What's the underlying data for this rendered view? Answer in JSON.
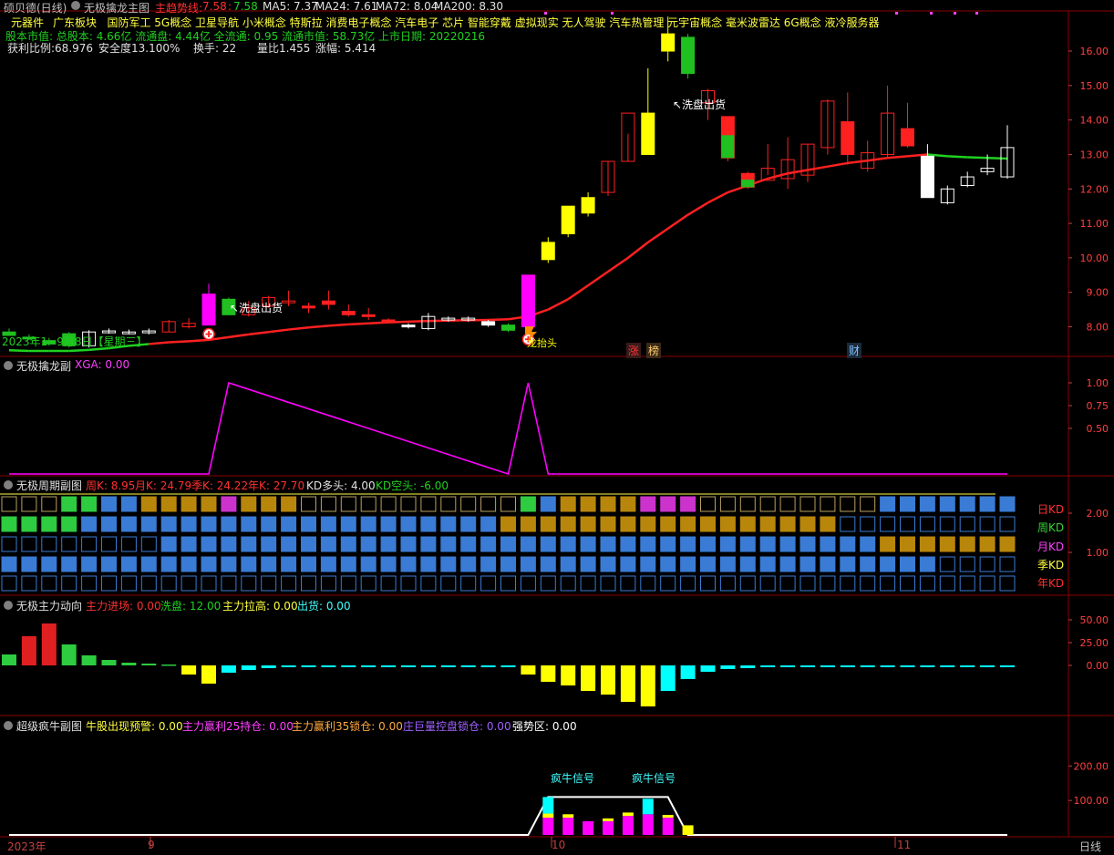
{
  "main": {
    "window_title": "硕贝德(日线)",
    "indicator_name": "无极擒龙主图",
    "trend_label": "主趋势线:",
    "trend_v1": "7.58",
    "trend_v2": "7.58",
    "ma5": "MA5: 7.37",
    "ma24": "MA24: 7.61",
    "ma72": "MA72: 8.04",
    "ma200": "MA200: 8.30",
    "concepts_head": "元器件",
    "concepts": "广东板块   国防军工 5G概念 卫星导航 小米概念 特斯拉 消费电子概念 汽车电子 芯片 智能穿戴 虚拟现实 无人驾驶 汽车热管理 元宇宙概念 毫米波雷达 6G概念 液冷服务器",
    "info_line": "股本市值: 总股本: 4.66亿 流通盘: 4.44亿 全流通: 0.95 流通市值: 58.73亿 上市日期: 20220216",
    "profit_ratio": "获利比例:68.976",
    "safety": "安全度13.100%",
    "turnover": "换手: 22",
    "vol_ratio": "量比1.455",
    "change": "涨幅: 5.414",
    "date_label": "2023年1~9月8日【星期三】",
    "wash_label_1": "↖洗盘出货",
    "wash_label_2": "↖洗盘出货",
    "dragon_label": "龙抬头",
    "events": [
      "涨",
      "榜",
      "财"
    ]
  },
  "sub1": {
    "title": "无极擒龙副",
    "value": "XGA: 0.00"
  },
  "sub2": {
    "title": "无极周期副图",
    "zhou": "周K: 8.95",
    "yue": "月K: 24.79",
    "ji": "季K: 24.22",
    "nian": "年K: 27.70",
    "duo": "KD多头: 4.00",
    "kong": "KD空头: -6.00",
    "rows": [
      {
        "label": "日KD",
        "color": "#ff3030"
      },
      {
        "label": "周KD",
        "color": "#3ad03a"
      },
      {
        "label": "月KD",
        "color": "#ff40ff"
      },
      {
        "label": "季KD",
        "color": "#ffff40"
      },
      {
        "label": "年KD",
        "color": "#ff3030"
      }
    ]
  },
  "sub3": {
    "title": "无极主力动向",
    "jinchang": "主力进场: 0.00",
    "xipan": "洗盘: 12.00",
    "lagao": "主力拉高: 0.00",
    "chuhuo": "出货: 0.00"
  },
  "sub4": {
    "title": "超级疯牛副图",
    "yujing": "牛股出现预警: 0.00",
    "chicang": "主力赢利25持仓: 0.00",
    "suocang35": "主力赢利35锁仓: 0.00",
    "kongpan": "庄巨量控盘锁仓: 0.00",
    "qiangshi": "强势区: 0.00",
    "signal1": "疯牛信号",
    "signal2": "疯牛信号"
  },
  "xaxis": {
    "year": "2023年",
    "m9": "9",
    "m10": "10",
    "m11": "11",
    "period": "日线"
  },
  "colors": {
    "up": "#ff2020",
    "down": "#20c020",
    "yellow": "#ffff00",
    "magenta": "#ff00ff",
    "cyan": "#00ffff",
    "blue": "#3a7bd5",
    "gold": "#b8860b"
  },
  "chart_data": [
    {
      "type": "candlestick",
      "title": "无极擒龙主图",
      "ylim": [
        7.3,
        16.9
      ],
      "y_ticks": [
        8.0,
        9.0,
        10.0,
        11.0,
        12.0,
        13.0,
        14.0,
        15.0,
        16.0
      ],
      "candles": [
        {
          "o": 7.85,
          "h": 7.95,
          "l": 7.75,
          "c": 7.75,
          "color": "green"
        },
        {
          "o": 7.7,
          "h": 7.78,
          "l": 7.62,
          "c": 7.65,
          "color": "green"
        },
        {
          "o": 7.6,
          "h": 7.68,
          "l": 7.45,
          "c": 7.5,
          "color": "green"
        },
        {
          "o": 7.8,
          "h": 7.85,
          "l": 7.4,
          "c": 7.45,
          "color": "green"
        },
        {
          "o": 7.45,
          "h": 7.9,
          "l": 7.4,
          "c": 7.85,
          "color": "white"
        },
        {
          "o": 7.85,
          "h": 7.95,
          "l": 7.8,
          "c": 7.88,
          "color": "white"
        },
        {
          "o": 7.85,
          "h": 7.92,
          "l": 7.78,
          "c": 7.85,
          "color": "white"
        },
        {
          "o": 7.85,
          "h": 7.95,
          "l": 7.78,
          "c": 7.88,
          "color": "white"
        },
        {
          "o": 7.85,
          "h": 8.2,
          "l": 7.85,
          "c": 8.15,
          "color": "red"
        },
        {
          "o": 8.0,
          "h": 8.25,
          "l": 7.95,
          "c": 8.1,
          "color": "red"
        },
        {
          "o": 8.05,
          "h": 9.25,
          "l": 8.05,
          "c": 8.95,
          "color": "magenta"
        },
        {
          "o": 8.8,
          "h": 8.85,
          "l": 8.4,
          "c": 8.35,
          "color": "green"
        },
        {
          "o": 8.35,
          "h": 8.75,
          "l": 8.3,
          "c": 8.55,
          "color": "red"
        },
        {
          "o": 8.6,
          "h": 8.9,
          "l": 8.55,
          "c": 8.85,
          "color": "red"
        },
        {
          "o": 8.7,
          "h": 9.05,
          "l": 8.6,
          "c": 8.75,
          "color": "red"
        },
        {
          "o": 8.6,
          "h": 8.7,
          "l": 8.4,
          "c": 8.55,
          "color": "redfill"
        },
        {
          "o": 8.75,
          "h": 9.05,
          "l": 8.5,
          "c": 8.65,
          "color": "redfill"
        },
        {
          "o": 8.45,
          "h": 8.65,
          "l": 8.3,
          "c": 8.35,
          "color": "redfill"
        },
        {
          "o": 8.35,
          "h": 8.55,
          "l": 8.2,
          "c": 8.3,
          "color": "redfill"
        },
        {
          "o": 8.2,
          "h": 8.25,
          "l": 8.1,
          "c": 8.15,
          "color": "redfill"
        },
        {
          "o": 8.05,
          "h": 8.1,
          "l": 7.95,
          "c": 8.0,
          "color": "whitefill"
        },
        {
          "o": 7.95,
          "h": 8.4,
          "l": 7.9,
          "c": 8.3,
          "color": "white"
        },
        {
          "o": 8.2,
          "h": 8.3,
          "l": 8.15,
          "c": 8.25,
          "color": "white"
        },
        {
          "o": 8.2,
          "h": 8.3,
          "l": 8.15,
          "c": 8.25,
          "color": "white"
        },
        {
          "o": 8.15,
          "h": 8.2,
          "l": 8.0,
          "c": 8.05,
          "color": "whitefill"
        },
        {
          "o": 8.05,
          "h": 8.1,
          "l": 7.85,
          "c": 7.9,
          "color": "greenfill"
        },
        {
          "o": 8.0,
          "h": 9.5,
          "l": 8.0,
          "c": 9.5,
          "color": "magenta"
        },
        {
          "o": 9.95,
          "h": 10.6,
          "l": 9.85,
          "c": 10.45,
          "color": "yellow"
        },
        {
          "o": 10.7,
          "h": 11.0,
          "l": 10.6,
          "c": 11.5,
          "color": "yellow"
        },
        {
          "o": 11.3,
          "h": 11.9,
          "l": 11.2,
          "c": 11.75,
          "color": "yellow"
        },
        {
          "o": 11.9,
          "h": 12.8,
          "l": 11.8,
          "c": 12.8,
          "color": "red"
        },
        {
          "o": 12.8,
          "h": 13.6,
          "l": 12.8,
          "c": 14.2,
          "color": "red"
        },
        {
          "o": 13.0,
          "h": 15.5,
          "l": 13.0,
          "c": 14.2,
          "color": "yellow"
        },
        {
          "o": 16.0,
          "h": 17.0,
          "l": 15.7,
          "c": 16.5,
          "color": "yellow"
        },
        {
          "o": 16.4,
          "h": 16.5,
          "l": 15.2,
          "c": 15.35,
          "color": "green"
        },
        {
          "o": 14.5,
          "h": 14.9,
          "l": 14.0,
          "c": 14.85,
          "color": "red"
        },
        {
          "o": 14.1,
          "h": 14.1,
          "l": 12.8,
          "c": 12.9,
          "color": "greenred"
        },
        {
          "o": 12.45,
          "h": 12.5,
          "l": 12.0,
          "c": 12.05,
          "color": "greenred"
        },
        {
          "o": 12.6,
          "h": 13.3,
          "l": 12.4,
          "c": 12.25,
          "color": "red"
        },
        {
          "o": 12.3,
          "h": 13.5,
          "l": 12.0,
          "c": 12.85,
          "color": "red"
        },
        {
          "o": 12.4,
          "h": 13.3,
          "l": 12.2,
          "c": 13.3,
          "color": "red"
        },
        {
          "o": 13.2,
          "h": 14.6,
          "l": 13.0,
          "c": 14.55,
          "color": "red"
        },
        {
          "o": 13.95,
          "h": 14.8,
          "l": 12.7,
          "c": 13.0,
          "color": "redfill"
        },
        {
          "o": 12.6,
          "h": 13.4,
          "l": 12.5,
          "c": 13.05,
          "color": "red"
        },
        {
          "o": 13.0,
          "h": 15.0,
          "l": 12.9,
          "c": 14.2,
          "color": "red"
        },
        {
          "o": 13.75,
          "h": 14.5,
          "l": 13.2,
          "c": 13.25,
          "color": "redfill"
        },
        {
          "o": 12.95,
          "h": 13.3,
          "l": 11.8,
          "c": 11.75,
          "color": "whitefill"
        },
        {
          "o": 11.6,
          "h": 12.1,
          "l": 11.55,
          "c": 12.0,
          "color": "white"
        },
        {
          "o": 12.1,
          "h": 12.5,
          "l": 12.05,
          "c": 12.35,
          "color": "white"
        },
        {
          "o": 12.5,
          "h": 13.0,
          "l": 12.4,
          "c": 12.6,
          "color": "white"
        },
        {
          "o": 12.35,
          "h": 13.85,
          "l": 12.3,
          "c": 13.2,
          "color": "white"
        }
      ],
      "trend_line": [
        7.32,
        7.3,
        7.3,
        7.3,
        7.33,
        7.38,
        7.45,
        7.5,
        7.55,
        7.58,
        7.62,
        7.7,
        7.78,
        7.85,
        7.92,
        7.98,
        8.03,
        8.07,
        8.1,
        8.13,
        8.15,
        8.17,
        8.18,
        8.19,
        8.2,
        8.22,
        8.3,
        8.5,
        8.8,
        9.2,
        9.6,
        10.0,
        10.45,
        10.85,
        11.25,
        11.6,
        11.9,
        12.1,
        12.3,
        12.45,
        12.55,
        12.65,
        12.75,
        12.82,
        12.9,
        12.95,
        13.0,
        12.95,
        12.92,
        12.9,
        12.88
      ]
    },
    {
      "type": "line",
      "title": "无极擒龙副",
      "series": [
        {
          "name": "XGA",
          "x": [
            0,
            10,
            11,
            25,
            26,
            27,
            50
          ],
          "y": [
            0,
            0,
            1,
            0,
            1,
            0,
            0
          ]
        }
      ],
      "ylim": [
        0,
        1.1
      ],
      "y_ticks": [
        0.5,
        0.75,
        1.0
      ]
    },
    {
      "type": "bar",
      "title": "无极主力动向",
      "ylim": [
        -55,
        60
      ],
      "y_ticks": [
        0.0,
        25.0,
        50.0
      ],
      "values": [
        12,
        32,
        46,
        23,
        11,
        6,
        3,
        2,
        1,
        -10,
        -20,
        -8,
        -5,
        -3,
        -2,
        -2,
        -2,
        -2,
        -2,
        -2,
        -2,
        -2,
        -2,
        -2,
        -2,
        -2,
        -10,
        -18,
        -22,
        -28,
        -32,
        -40,
        -45,
        -28,
        -15,
        -7,
        -4,
        -3,
        -2,
        -2,
        -2,
        -2,
        -2,
        -2,
        -2,
        -2,
        -2,
        -2,
        -2,
        -2,
        -2
      ],
      "color_keys": [
        "g",
        "r",
        "r",
        "g",
        "g",
        "g",
        "g",
        "g",
        "g",
        "y",
        "y",
        "c",
        "c",
        "c",
        "c",
        "c",
        "c",
        "c",
        "c",
        "c",
        "c",
        "c",
        "c",
        "c",
        "c",
        "c",
        "y",
        "y",
        "y",
        "y",
        "y",
        "y",
        "y",
        "c",
        "c",
        "c",
        "c",
        "c",
        "c",
        "c",
        "c",
        "c",
        "c",
        "c",
        "c",
        "c",
        "c",
        "c",
        "c",
        "c",
        "c"
      ]
    },
    {
      "type": "bar",
      "title": "超级疯牛副图",
      "ylim": [
        0,
        250
      ],
      "y_ticks": [
        100.0,
        200.0
      ],
      "magenta_values": [
        0,
        0,
        0,
        0,
        0,
        0,
        0,
        0,
        0,
        0,
        0,
        0,
        0,
        0,
        0,
        0,
        0,
        0,
        0,
        0,
        0,
        0,
        0,
        0,
        0,
        0,
        0,
        50,
        50,
        40,
        40,
        55,
        60,
        50,
        0,
        0,
        0,
        0,
        0,
        0,
        0,
        0,
        0,
        0,
        0,
        0,
        0,
        0,
        0,
        0,
        0
      ],
      "yellow_values": [
        0,
        0,
        0,
        0,
        0,
        0,
        0,
        0,
        0,
        0,
        0,
        0,
        0,
        0,
        0,
        0,
        0,
        0,
        0,
        0,
        0,
        0,
        0,
        0,
        0,
        0,
        0,
        12,
        10,
        0,
        8,
        10,
        0,
        8,
        28,
        0,
        0,
        0,
        0,
        0,
        0,
        0,
        0,
        0,
        0,
        0,
        0,
        0,
        0,
        0,
        0
      ],
      "cyan_values": [
        0,
        0,
        0,
        0,
        0,
        0,
        0,
        0,
        0,
        0,
        0,
        0,
        0,
        0,
        0,
        0,
        0,
        0,
        0,
        0,
        0,
        0,
        0,
        0,
        0,
        0,
        0,
        48,
        0,
        0,
        0,
        0,
        45,
        0,
        0,
        0,
        0,
        0,
        0,
        0,
        0,
        0,
        0,
        0,
        0,
        0,
        0,
        0,
        0,
        0,
        0
      ],
      "white_line": [
        0,
        0,
        0,
        0,
        0,
        0,
        0,
        0,
        0,
        0,
        0,
        0,
        0,
        0,
        0,
        0,
        0,
        0,
        0,
        0,
        0,
        0,
        0,
        0,
        0,
        0,
        0,
        110,
        110,
        110,
        110,
        110,
        110,
        110,
        0,
        0,
        0,
        0,
        0,
        0,
        0,
        0,
        0,
        0,
        0,
        0,
        0,
        0,
        0,
        0,
        0
      ]
    }
  ]
}
